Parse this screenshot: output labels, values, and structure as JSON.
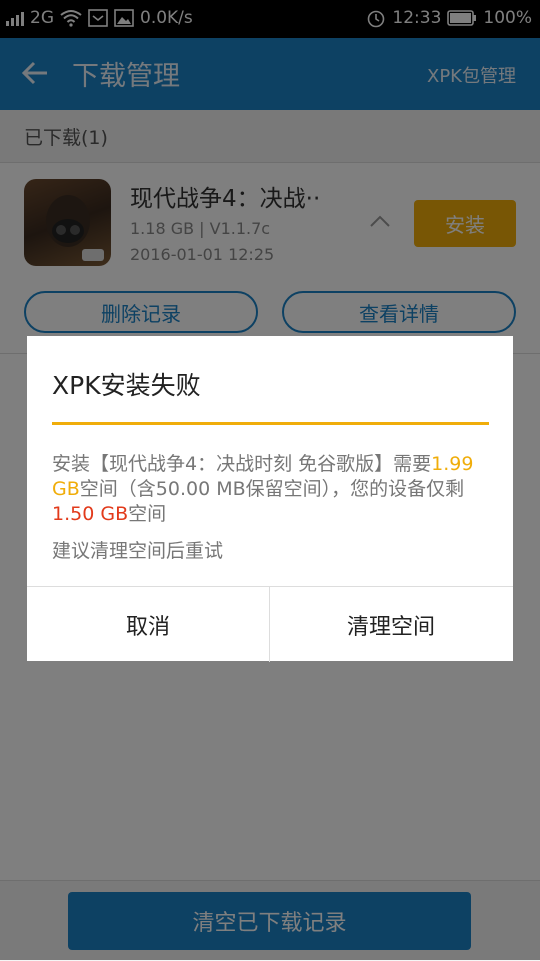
{
  "status_bar": {
    "network": "2G",
    "speed": "0.0K/s",
    "time": "12:33",
    "battery": "100%"
  },
  "app_bar": {
    "title": "下载管理",
    "right_action": "XPK包管理"
  },
  "section": {
    "label": "已下载(1)"
  },
  "item": {
    "name": "现代战争4：决战··",
    "meta": "1.18 GB | V1.1.7c",
    "date": "2016-01-01 12:25",
    "install_label": "安装",
    "delete_label": "删除记录",
    "detail_label": "查看详情"
  },
  "bottom": {
    "clear_label": "清空已下载记录"
  },
  "dialog": {
    "title": "XPK安装失败",
    "msg_part1": "安装【现代战争4：决战时刻 免谷歌版】需要",
    "required_size": "1.99 GB",
    "msg_part2": "空间（含50.00 MB保留空间），您的设备仅剩",
    "remaining_size": "1.50 GB",
    "msg_part3": "空间",
    "suggestion": "建议清理空间后重试",
    "cancel_label": "取消",
    "clean_label": "清理空间"
  },
  "colors": {
    "primary": "#1b82c7",
    "accent": "#f0ad0a",
    "warning": "#e23a1b"
  }
}
